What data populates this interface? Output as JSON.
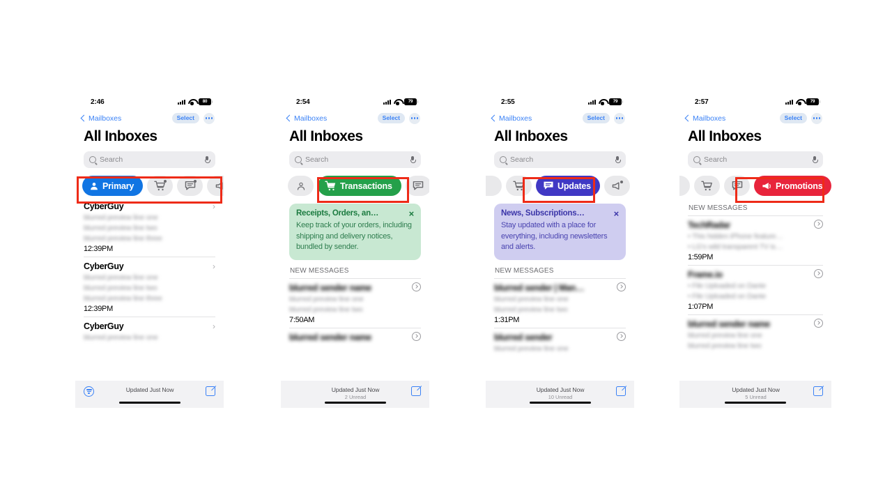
{
  "meta": {
    "app": "Apple Mail",
    "highlight_color": "#ee2b18",
    "description": "Four iPhone Mail app screenshots showing the category tab bar with Primary, Transactions, Updates and Promotions selected"
  },
  "screens": [
    {
      "id": "primary",
      "status": {
        "time": "2:46",
        "battery": "80"
      },
      "nav": {
        "back": "Mailboxes",
        "select": "Select",
        "more": "more-options"
      },
      "title": "All Inboxes",
      "search": {
        "placeholder": "Search"
      },
      "tabs": {
        "active_index": 0,
        "items": [
          {
            "key": "primary",
            "label": "Primary",
            "icon": "person-icon",
            "color": "#1175e3",
            "active": true,
            "badge": false
          },
          {
            "key": "transactions",
            "label": "Transactions",
            "icon": "cart-icon",
            "color": "#24a04a",
            "active": false,
            "badge": true
          },
          {
            "key": "updates",
            "label": "Updates",
            "icon": "chat-bubble-icon",
            "color": "#4038c4",
            "active": false,
            "badge": true
          },
          {
            "key": "promotions",
            "label": "Promotions",
            "icon": "megaphone-icon",
            "color": "#e8243c",
            "active": false,
            "badge": false
          }
        ]
      },
      "promo": null,
      "section_header": null,
      "rows": [
        {
          "title": "CyberGuy",
          "blurred_title": false,
          "lines": [
            "blurred preview line one",
            "blurred preview line two",
            "blurred preview line three"
          ],
          "time": "12:39PM",
          "chevron": "plain"
        },
        {
          "title": "CyberGuy",
          "blurred_title": false,
          "lines": [
            "blurred preview line one",
            "blurred preview line two",
            "blurred preview line three"
          ],
          "time": "12:39PM",
          "chevron": "plain"
        },
        {
          "title": "CyberGuy",
          "blurred_title": false,
          "lines": [
            "blurred preview line one"
          ],
          "time": "",
          "chevron": "plain"
        }
      ],
      "bottom": {
        "filter_icon": true,
        "main": "Updated Just Now",
        "sub": "",
        "compose_icon": "compose-icon"
      }
    },
    {
      "id": "transactions",
      "status": {
        "time": "2:54",
        "battery": "79"
      },
      "nav": {
        "back": "Mailboxes",
        "select": "Select",
        "more": "more-options"
      },
      "title": "All Inboxes",
      "search": {
        "placeholder": "Search"
      },
      "tabs": {
        "active_index": 1,
        "items": [
          {
            "key": "primary",
            "label": "Primary",
            "icon": "person-icon",
            "color": "#1175e3",
            "active": false,
            "badge": false
          },
          {
            "key": "transactions",
            "label": "Transactions",
            "icon": "cart-icon",
            "color": "#24a04a",
            "active": true,
            "badge": false
          },
          {
            "key": "updates",
            "label": "Updates",
            "icon": "chat-bubble-icon",
            "color": "#4038c4",
            "active": false,
            "badge": false
          }
        ]
      },
      "promo": {
        "theme": "green",
        "title": "Receipts, Orders, an…",
        "close": "×",
        "body": "Keep track of your orders, including shipping and delivery notices, bundled by sender."
      },
      "section_header": "NEW MESSAGES",
      "rows": [
        {
          "title": "blurred sender name",
          "blurred_title": true,
          "lines": [
            "blurred preview line one",
            "blurred preview line two"
          ],
          "time": "7:50AM",
          "chevron": "circle"
        },
        {
          "title": "blurred sender name",
          "blurred_title": true,
          "lines": [],
          "time": "",
          "chevron": "circle"
        }
      ],
      "bottom": {
        "filter_icon": false,
        "main": "Updated Just Now",
        "sub": "2 Unread",
        "compose_icon": "compose-icon"
      }
    },
    {
      "id": "updates",
      "status": {
        "time": "2:55",
        "battery": "79"
      },
      "nav": {
        "back": "Mailboxes",
        "select": "Select",
        "more": "more-options"
      },
      "title": "All Inboxes",
      "search": {
        "placeholder": "Search"
      },
      "tabs": {
        "active_index": 1,
        "items": [
          {
            "key": "transactions",
            "label": "Transactions",
            "icon": "cart-icon",
            "color": "#24a04a",
            "active": false,
            "badge": false
          },
          {
            "key": "updates",
            "label": "Updates",
            "icon": "chat-bubble-icon",
            "color": "#4038c4",
            "active": true,
            "badge": false
          },
          {
            "key": "promotions",
            "label": "Promotions",
            "icon": "megaphone-icon",
            "color": "#e8243c",
            "active": false,
            "badge": true
          }
        ]
      },
      "promo": {
        "theme": "purple",
        "title": "News, Subscriptions…",
        "close": "×",
        "body": "Stay updated with a place for everything, including newsletters and alerts."
      },
      "section_header": "NEW MESSAGES",
      "rows": [
        {
          "title": "blurred sender | Man…",
          "blurred_title": true,
          "lines": [
            "blurred preview line one",
            "blurred preview line two"
          ],
          "time": "1:31PM",
          "chevron": "circle"
        },
        {
          "title": "blurred sender",
          "blurred_title": true,
          "lines": [
            "blurred preview line one"
          ],
          "time": "",
          "chevron": "circle"
        }
      ],
      "bottom": {
        "filter_icon": false,
        "main": "Updated Just Now",
        "sub": "10 Unread",
        "compose_icon": "compose-icon"
      }
    },
    {
      "id": "promotions",
      "status": {
        "time": "2:57",
        "battery": "79"
      },
      "nav": {
        "back": "Mailboxes",
        "select": "Select",
        "more": "more-options"
      },
      "title": "All Inboxes",
      "search": {
        "placeholder": "Search"
      },
      "tabs": {
        "active_index": 2,
        "items": [
          {
            "key": "transactions",
            "label": "Transactions",
            "icon": "cart-icon",
            "color": "#24a04a",
            "active": false,
            "badge": false
          },
          {
            "key": "updates",
            "label": "Updates",
            "icon": "chat-bubble-icon",
            "color": "#4038c4",
            "active": false,
            "badge": false
          },
          {
            "key": "promotions",
            "label": "Promotions",
            "icon": "megaphone-icon",
            "color": "#e8243c",
            "active": true,
            "badge": false
          }
        ]
      },
      "promo": null,
      "section_header": "NEW MESSAGES",
      "rows": [
        {
          "title": "TechRadar",
          "blurred_title": true,
          "lines": [
            "• This hidden iPhone feature…",
            "• LG's wild transparent TV is…"
          ],
          "time": "1:59PM",
          "chevron": "circle"
        },
        {
          "title": "Frame.io",
          "blurred_title": true,
          "lines": [
            "• File Uploaded on Dante",
            "• File Uploaded on Dante"
          ],
          "time": "1:07PM",
          "chevron": "circle"
        },
        {
          "title": "blurred sender name",
          "blurred_title": true,
          "lines": [
            "blurred preview line one",
            "blurred preview line two"
          ],
          "time": "",
          "chevron": "circle"
        }
      ],
      "bottom": {
        "filter_icon": false,
        "main": "Updated Just Now",
        "sub": "5 Unread",
        "compose_icon": "compose-icon"
      }
    }
  ]
}
